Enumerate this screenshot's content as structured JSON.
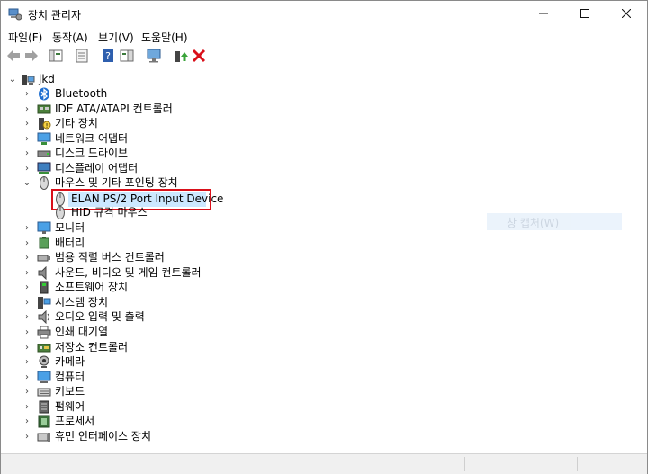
{
  "window": {
    "title": "장치 관리자",
    "min_icon": "minimize-icon",
    "max_icon": "maximize-icon",
    "close_icon": "close-icon"
  },
  "menu": [
    "파일(F)",
    "동작(A)",
    "보기(V)",
    "도움말(H)"
  ],
  "toolbar_icons": [
    "back-arrow-icon",
    "forward-arrow-icon",
    "console-tree-icon",
    "properties-icon",
    "help-icon",
    "action-pane-icon",
    "monitor-scan-icon",
    "update-driver-icon",
    "uninstall-icon"
  ],
  "colors": {
    "highlight_border": "#d9101a",
    "selection": "#cce8ff",
    "uninstall_red": "#d9101a"
  },
  "tree": {
    "root": "jkd",
    "categories": [
      {
        "label": "Bluetooth",
        "icon": "bluetooth-icon"
      },
      {
        "label": "IDE ATA/ATAPI 컨트롤러",
        "icon": "ide-controller-icon"
      },
      {
        "label": "기타 장치",
        "icon": "other-devices-icon"
      },
      {
        "label": "네트워크 어댑터",
        "icon": "network-adapter-icon"
      },
      {
        "label": "디스크 드라이브",
        "icon": "disk-drive-icon"
      },
      {
        "label": "디스플레이 어댑터",
        "icon": "display-adapter-icon"
      },
      {
        "label": "마우스 및 기타 포인팅 장치",
        "icon": "mouse-icon"
      }
    ],
    "mouse_children": [
      {
        "label": "ELAN PS/2 Port Input Device",
        "icon": "mouse-icon"
      },
      {
        "label": "HID 규격 마우스",
        "icon": "mouse-icon"
      }
    ],
    "categories_after": [
      {
        "label": "모니터",
        "icon": "monitor-icon"
      },
      {
        "label": "배터리",
        "icon": "battery-icon"
      },
      {
        "label": "범용 직렬 버스 컨트롤러",
        "icon": "usb-controller-icon"
      },
      {
        "label": "사운드, 비디오 및 게임 컨트롤러",
        "icon": "sound-icon"
      },
      {
        "label": "소프트웨어 장치",
        "icon": "software-device-icon"
      },
      {
        "label": "시스템 장치",
        "icon": "system-device-icon"
      },
      {
        "label": "오디오 입력 및 출력",
        "icon": "audio-io-icon"
      },
      {
        "label": "인쇄 대기열",
        "icon": "print-queue-icon"
      },
      {
        "label": "저장소 컨트롤러",
        "icon": "storage-controller-icon"
      },
      {
        "label": "카메라",
        "icon": "camera-icon"
      },
      {
        "label": "컴퓨터",
        "icon": "computer-icon"
      },
      {
        "label": "키보드",
        "icon": "keyboard-icon"
      },
      {
        "label": "펌웨어",
        "icon": "firmware-icon"
      },
      {
        "label": "프로세서",
        "icon": "processor-icon"
      },
      {
        "label": "휴먼 인터페이스 장치",
        "icon": "hid-icon"
      }
    ]
  },
  "overlay_text": "창 캡처(W)"
}
